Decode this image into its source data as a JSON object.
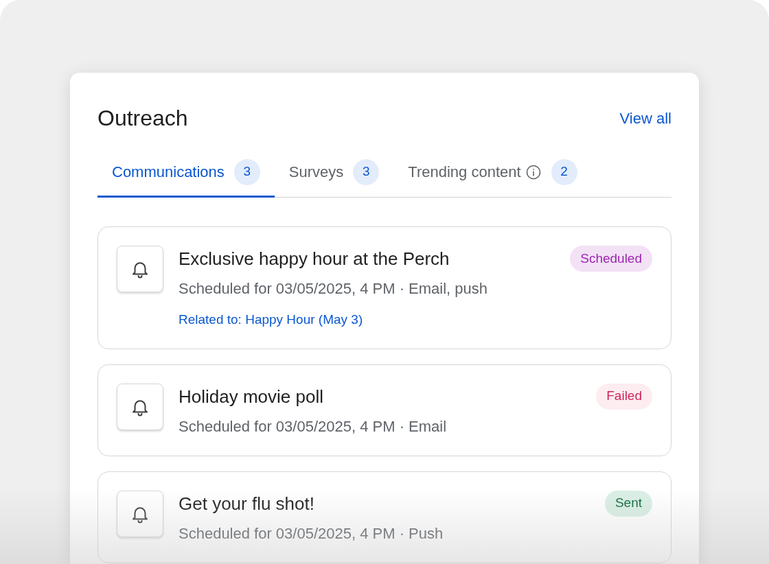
{
  "title": "Outreach",
  "view_all": "View all",
  "tabs": [
    {
      "label": "Communications",
      "count": "3",
      "selected": true,
      "info": false
    },
    {
      "label": "Surveys",
      "count": "3",
      "selected": false,
      "info": false
    },
    {
      "label": "Trending content",
      "count": "2",
      "selected": false,
      "info": true
    }
  ],
  "items": [
    {
      "title": "Exclusive happy hour at the Perch",
      "subtitle": "Scheduled for 03/05/2025, 4 PM · Email, push",
      "link": "Related to: Happy Hour (May 3)",
      "status": {
        "label": "Scheduled",
        "kind": "scheduled"
      }
    },
    {
      "title": "Holiday movie poll",
      "subtitle": "Scheduled for 03/05/2025, 4 PM · Email",
      "status": {
        "label": "Failed",
        "kind": "failed"
      }
    },
    {
      "title": "Get your flu shot!",
      "subtitle": "Scheduled for 03/05/2025, 4 PM · Push",
      "status": {
        "label": "Sent",
        "kind": "sent"
      }
    }
  ]
}
